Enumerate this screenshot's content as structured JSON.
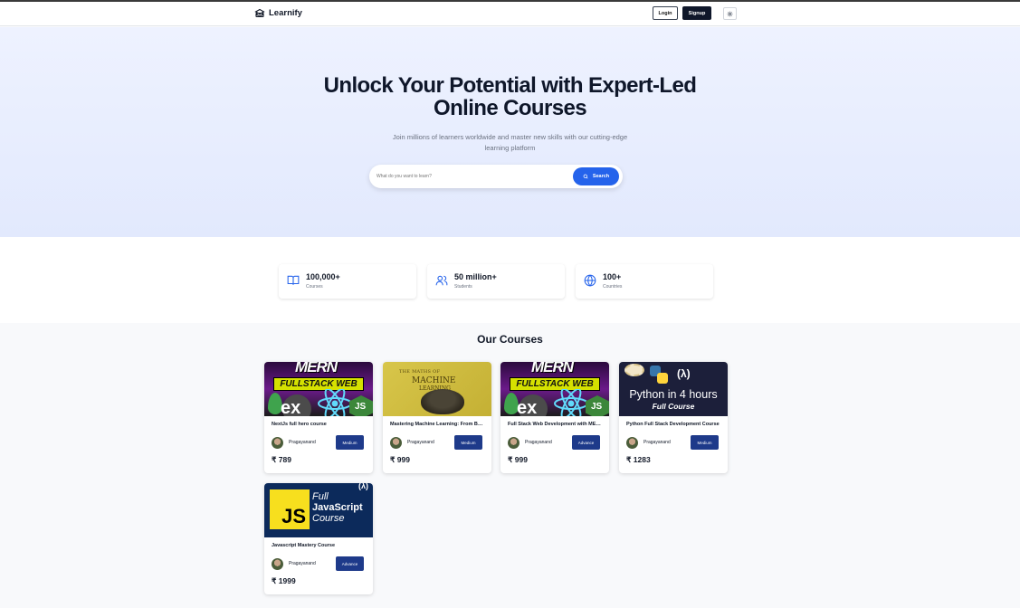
{
  "brand": {
    "name": "Learnify"
  },
  "nav": {
    "login": "Login",
    "signup": "Signup"
  },
  "hero": {
    "title_line1": "Unlock Your Potential with Expert-Led",
    "title_line2": "Online Courses",
    "subtitle_line1": "Join millions of learners worldwide and master new skills with our cutting-edge",
    "subtitle_line2": "learning platform",
    "search_placeholder": "What do you want to learn?",
    "search_button": "Search"
  },
  "stats": [
    {
      "value": "100,000+",
      "label": "Courses",
      "icon": "book-icon"
    },
    {
      "value": "50 million+",
      "label": "Students",
      "icon": "users-icon"
    },
    {
      "value": "100+",
      "label": "Countries",
      "icon": "globe-icon"
    }
  ],
  "courses_section": {
    "title": "Our Courses"
  },
  "courses": [
    {
      "title": "NextJs full hero course",
      "instructor": "Pragayanand",
      "level": "Medium",
      "price": "₹ 789",
      "thumb": "mern"
    },
    {
      "title": "Mastering Machine Learning: From Basics to Advanced",
      "instructor": "Pragayanand",
      "level": "Medium",
      "price": "₹ 999",
      "thumb": "ml"
    },
    {
      "title": "Full Stack Web Development with MERN",
      "instructor": "Pragayanand",
      "level": "Advance",
      "price": "₹ 999",
      "thumb": "mern"
    },
    {
      "title": "Python Full Stack Development Course",
      "instructor": "Pragayanand",
      "level": "Medium",
      "price": "₹ 1283",
      "thumb": "python"
    },
    {
      "title": "Javascript Mastery Course",
      "instructor": "Pragayanand",
      "level": "Advance",
      "price": "₹ 1999",
      "thumb": "js"
    }
  ],
  "thumbnails": {
    "mern": {
      "line1": "MERN",
      "line2": "FULLSTACK WEB",
      "ex": "ex",
      "js": "JS"
    },
    "ml": {
      "line1": "THE MATHS OF",
      "line2": "MACHINE",
      "line3": "LEARNING"
    },
    "python": {
      "fcc": "(λ)",
      "line1": "Python in 4 hours",
      "line2": "Full Course"
    },
    "js": {
      "badge": "JS",
      "line1": "Full",
      "line2": "JavaScript",
      "line3": "Course",
      "fcc": "(λ)"
    }
  },
  "colors": {
    "primary": "#2563eb",
    "badge": "#1e3a8a",
    "dark": "#0f172a"
  }
}
